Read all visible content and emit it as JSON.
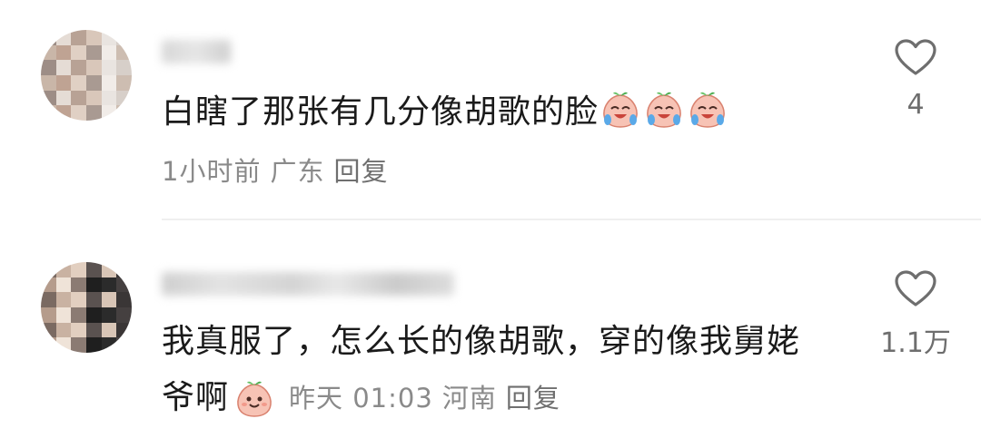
{
  "comments": [
    {
      "content": "白瞎了那张有几分像胡歌的脸",
      "emoji_count": 3,
      "time": "1小时前",
      "location": "广东",
      "reply_label": "回复",
      "like_count": "4"
    },
    {
      "content_line1": "我真服了，怎么长的像胡歌，穿的像我舅姥",
      "content_line2": "爷啊",
      "time": "昨天 01:03",
      "location": "河南",
      "reply_label": "回复",
      "like_count": "1.1万"
    }
  ],
  "colors": {
    "text": "#1a1a1a",
    "meta": "#8a8a8a",
    "like_icon": "#6e6e6e",
    "divider": "#efefef"
  },
  "icons": {
    "like": "heart-outline-icon",
    "emoji_laugh_cry": "laugh-cry-peach-emoji-icon",
    "emoji_smile": "smile-peach-emoji-icon"
  }
}
